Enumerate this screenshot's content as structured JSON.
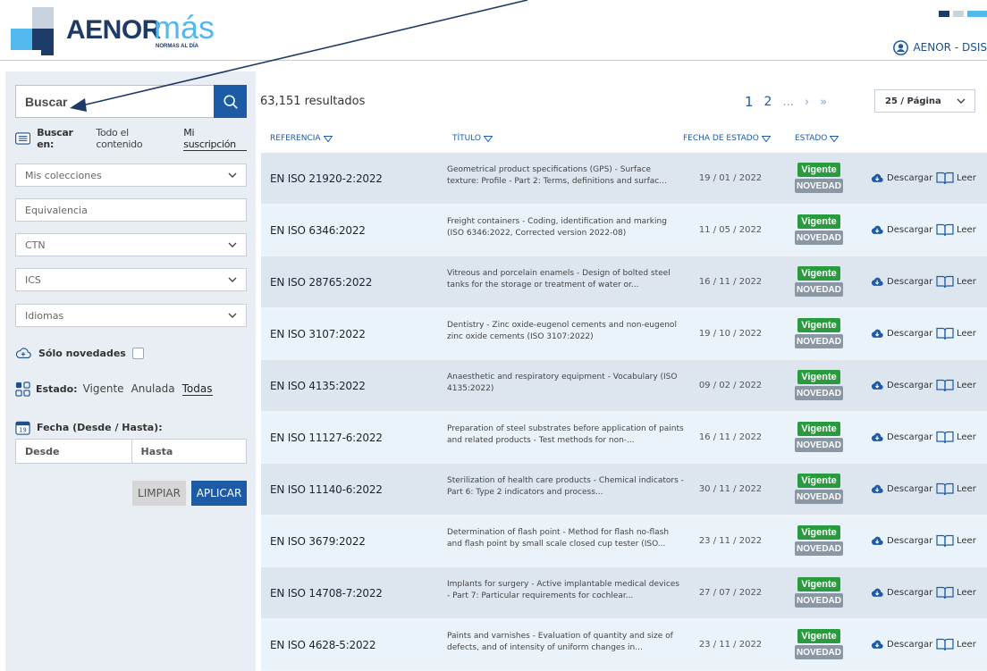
{
  "colors": {
    "brand_dark": "#1e3a66",
    "brand_light": "#52b8ee",
    "accent_blue": "#1d5ba6",
    "sidebar_bg": "#e9eef4",
    "row_even": "#dde6ef",
    "row_odd": "#eaf3f9",
    "vigente_green": "#2a9a3e",
    "novedad_gray": "#8a97a5"
  },
  "header": {
    "logo_name": "AENOR",
    "logo_suffix": "más",
    "logo_tagline": "NORMAS AL DÍA",
    "user_icon": "user-circle-icon",
    "user_label": "AENOR - DSIS"
  },
  "sidebar": {
    "search_placeholder": "Buscar",
    "search_icon": "search-icon",
    "scope_label": "Buscar en:",
    "scope_options": [
      "Todo el contenido",
      "Mi suscripción"
    ],
    "scope_active": "Mi suscripción",
    "filters": {
      "collections": "Mis colecciones",
      "equivalence": "Equivalencia",
      "ctn": "CTN",
      "ics": "ICS",
      "languages": "Idiomas"
    },
    "only_new_label": "Sólo novedades",
    "only_new_checked": false,
    "estado_label": "Estado:",
    "estado_options": [
      "Vigente",
      "Anulada",
      "Todas"
    ],
    "estado_active": "Todas",
    "fecha_label": "Fecha (Desde / Hasta):",
    "fecha_icon_text": "19",
    "date_from_placeholder": "Desde",
    "date_to_placeholder": "Hasta",
    "clear_label": "LIMPIAR",
    "apply_label": "APLICAR"
  },
  "results": {
    "count_text": "63,151 resultados",
    "pagination": {
      "current": "1",
      "next_page": "2",
      "ellipsis": "...",
      "next": "›",
      "last": "»"
    },
    "page_size": "25 / Página",
    "columns": {
      "ref": "REFERENCIA",
      "title": "TÍTULO",
      "date": "FECHA DE ESTADO",
      "status": "ESTADO"
    },
    "download_label": "Descargar",
    "read_label": "Leer",
    "rows": [
      {
        "ref": "EN ISO 21920-2:2022",
        "title": "Geometrical product specifications (GPS) - Surface texture: Profile - Part 2: Terms, definitions and surfac...",
        "date": "19 / 01 / 2022",
        "status": "Vigente",
        "flag": "NOVEDAD"
      },
      {
        "ref": "EN ISO 6346:2022",
        "title": "Freight containers - Coding, identification and marking (ISO 6346:2022, Corrected version 2022-08)",
        "date": "11 / 05 / 2022",
        "status": "Vigente",
        "flag": "NOVEDAD"
      },
      {
        "ref": "EN ISO 28765:2022",
        "title": "Vitreous and porcelain enamels - Design of bolted steel tanks for the storage or treatment of water or...",
        "date": "16 / 11 / 2022",
        "status": "Vigente",
        "flag": "NOVEDAD"
      },
      {
        "ref": "EN ISO 3107:2022",
        "title": "Dentistry - Zinc oxide-eugenol cements and non-eugenol zinc oxide cements (ISO 3107:2022)",
        "date": "19 / 10 / 2022",
        "status": "Vigente",
        "flag": "NOVEDAD"
      },
      {
        "ref": "EN ISO 4135:2022",
        "title": "Anaesthetic and respiratory equipment - Vocabulary (ISO 4135:2022)",
        "date": "09 / 02 / 2022",
        "status": "Vigente",
        "flag": "NOVEDAD"
      },
      {
        "ref": "EN ISO 11127-6:2022",
        "title": "Preparation of steel substrates before application of paints and related products - Test methods for non-...",
        "date": "16 / 11 / 2022",
        "status": "Vigente",
        "flag": "NOVEDAD"
      },
      {
        "ref": "EN ISO 11140-6:2022",
        "title": "Sterilization of health care products - Chemical indicators - Part 6: Type 2 indicators and process...",
        "date": "30 / 11 / 2022",
        "status": "Vigente",
        "flag": "NOVEDAD"
      },
      {
        "ref": "EN ISO 3679:2022",
        "title": "Determination of flash point - Method for flash no-flash and flash point by small scale closed cup tester (ISO...",
        "date": "23 / 11 / 2022",
        "status": "Vigente",
        "flag": "NOVEDAD"
      },
      {
        "ref": "EN ISO 14708-7:2022",
        "title": "Implants for surgery - Active implantable medical devices - Part 7: Particular requirements for cochlear...",
        "date": "27 / 07 / 2022",
        "status": "Vigente",
        "flag": "NOVEDAD"
      },
      {
        "ref": "EN ISO 4628-5:2022",
        "title": "Paints and varnishes - Evaluation of quantity and size of defects, and of intensity of uniform changes in...",
        "date": "23 / 11 / 2022",
        "status": "Vigente",
        "flag": "NOVEDAD"
      }
    ]
  }
}
